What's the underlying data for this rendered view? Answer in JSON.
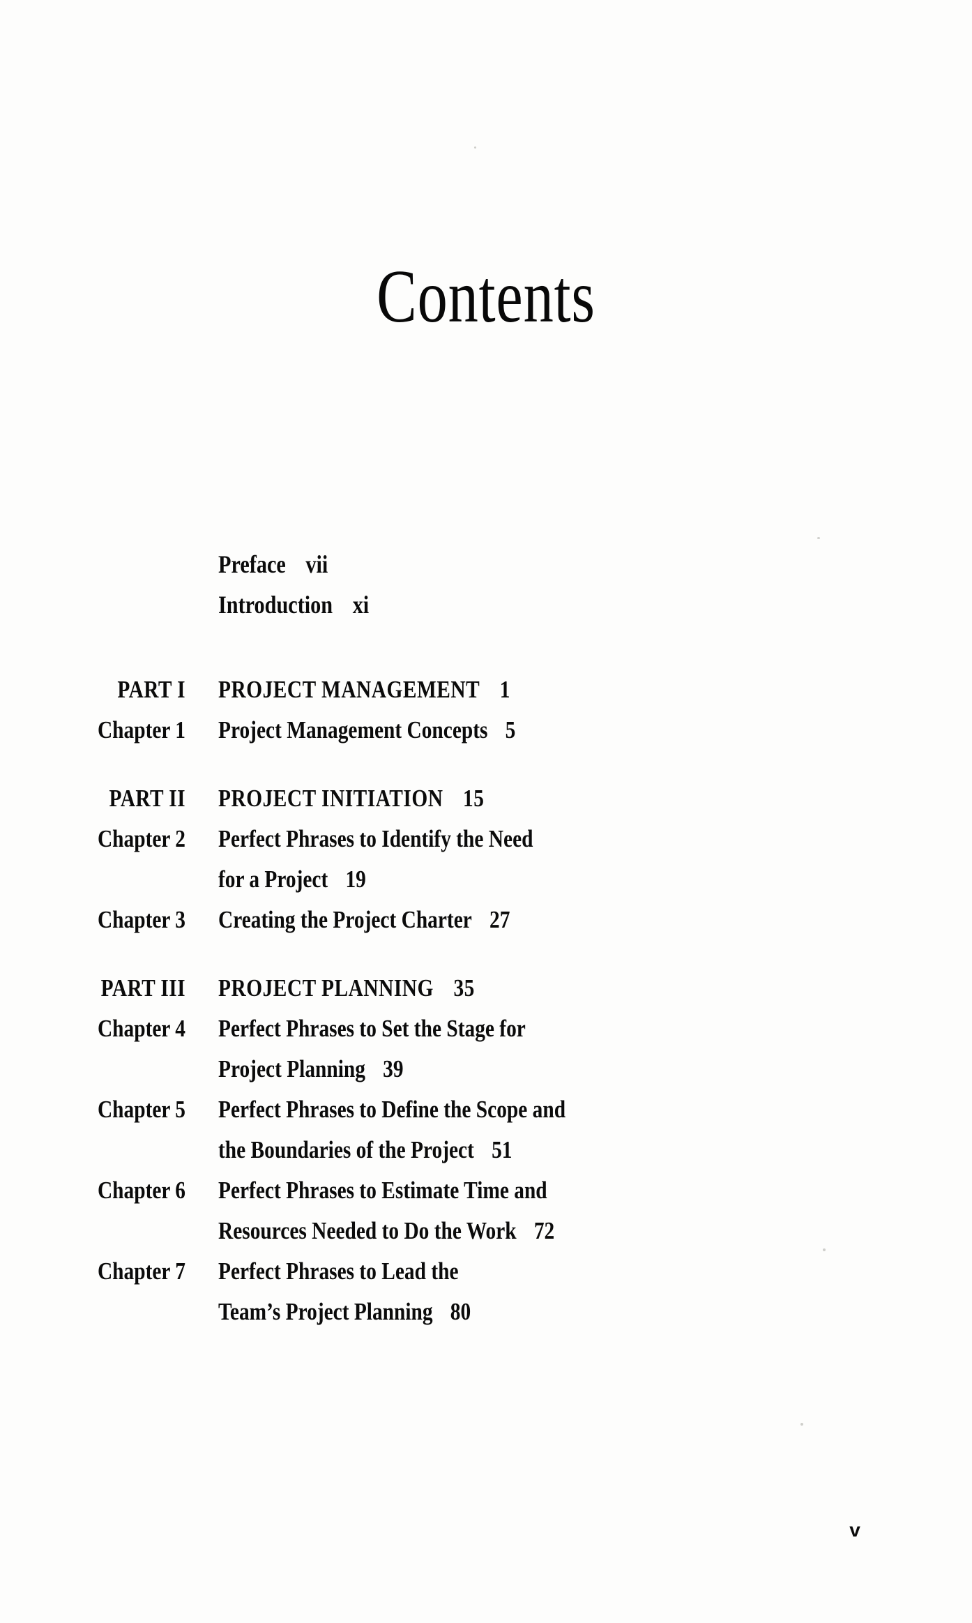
{
  "page": {
    "title": "Contents",
    "folio": "v"
  },
  "frontmatter": [
    {
      "label": "Preface",
      "page": "vii"
    },
    {
      "label": "Introduction",
      "page": "xi"
    }
  ],
  "parts": [
    {
      "part_label": "PART I",
      "part_title": "PROJECT MANAGEMENT",
      "part_page": "1",
      "chapters": [
        {
          "label": "Chapter 1",
          "lines": [
            "Project Management Concepts"
          ],
          "page": "5"
        }
      ]
    },
    {
      "part_label": "PART II",
      "part_title": "PROJECT INITIATION",
      "part_page": "15",
      "chapters": [
        {
          "label": "Chapter 2",
          "lines": [
            "Perfect Phrases to Identify the Need",
            "for a Project"
          ],
          "page": "19"
        },
        {
          "label": "Chapter 3",
          "lines": [
            "Creating the Project Charter"
          ],
          "page": "27"
        }
      ]
    },
    {
      "part_label": "PART III",
      "part_title": "PROJECT PLANNING",
      "part_page": "35",
      "chapters": [
        {
          "label": "Chapter 4",
          "lines": [
            "Perfect Phrases to Set the Stage for",
            "Project Planning"
          ],
          "page": "39"
        },
        {
          "label": "Chapter 5",
          "lines": [
            "Perfect Phrases to Define the Scope and",
            "the Boundaries of the Project"
          ],
          "page": "51"
        },
        {
          "label": "Chapter 6",
          "lines": [
            "Perfect Phrases to Estimate Time and",
            "Resources Needed to Do the Work"
          ],
          "page": "72"
        },
        {
          "label": "Chapter 7",
          "lines": [
            "Perfect Phrases to Lead the",
            "Team’s Project Planning"
          ],
          "page": "80"
        }
      ]
    }
  ],
  "colors": {
    "ink": "#0b0b0b",
    "paper": "#fdfdfc"
  }
}
